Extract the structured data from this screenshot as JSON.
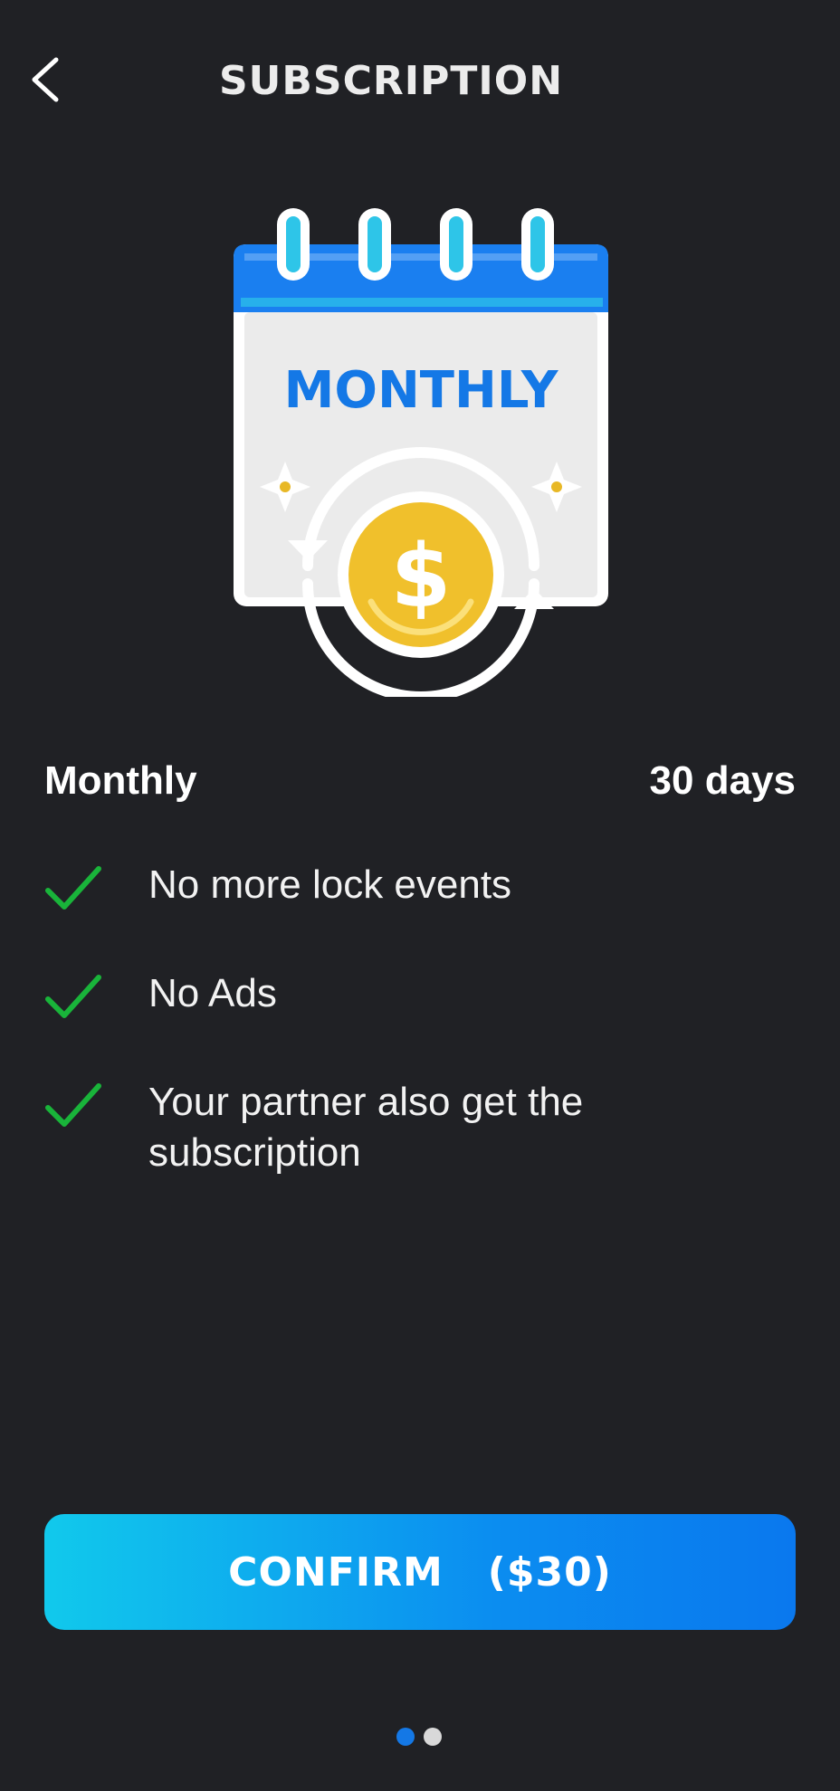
{
  "header": {
    "title": "SUBSCRIPTION",
    "back_icon": "chevron-left-icon"
  },
  "illustration": {
    "calendar_label": "MONTHLY",
    "icons": [
      "calendar-icon",
      "dollar-coin-icon",
      "renew-arrows-icon",
      "sparkle-icon"
    ],
    "colors": {
      "calendar_header": "#1a7ff0",
      "calendar_label": "#1478e6",
      "coin": "#f0c02c",
      "rings": "#2ec5e8"
    }
  },
  "plan": {
    "name": "Monthly",
    "duration": "30 days"
  },
  "features": [
    {
      "icon": "check-icon",
      "text": "No more lock events"
    },
    {
      "icon": "check-icon",
      "text": "No Ads"
    },
    {
      "icon": "check-icon",
      "text": "Your partner also get the subscription"
    }
  ],
  "confirm_button": {
    "label": "CONFIRM   ($30)"
  },
  "pager": {
    "pages": 2,
    "active_index": 0
  },
  "colors": {
    "background": "#202125",
    "check": "#19b43a",
    "button_gradient_start": "#11c9ec",
    "button_gradient_end": "#0a78ee",
    "active_dot": "#1478e6",
    "inactive_dot": "#d9d9d9"
  }
}
